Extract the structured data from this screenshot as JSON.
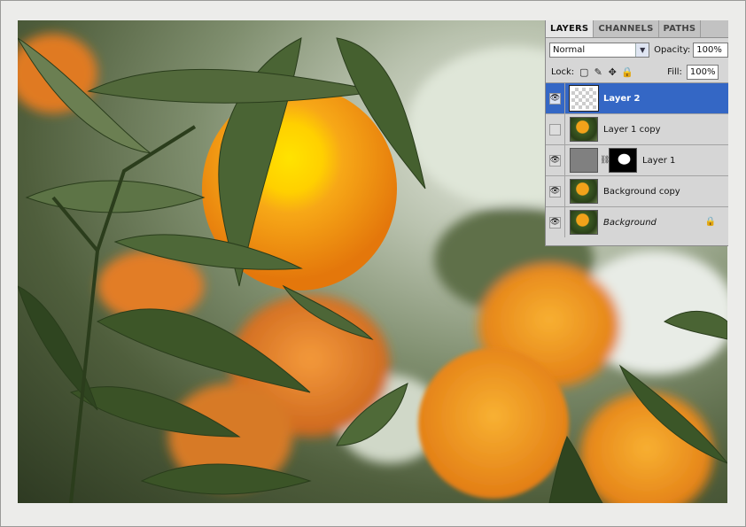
{
  "panel": {
    "tabs": [
      "LAYERS",
      "CHANNELS",
      "PATHS"
    ],
    "active_tab": "LAYERS",
    "blend_mode": "Normal",
    "opacity_label": "Opacity:",
    "opacity_value": "100%",
    "lock_label": "Lock:",
    "fill_label": "Fill:",
    "fill_value": "100%",
    "lock_icons": [
      "lock-transparent-icon",
      "lock-paint-icon",
      "lock-move-icon",
      "lock-all-icon"
    ]
  },
  "layers": [
    {
      "name": "Layer 2",
      "visible": true,
      "selected": true,
      "thumb": "transparent"
    },
    {
      "name": "Layer 1 copy",
      "visible": false,
      "selected": false,
      "thumb": "photo"
    },
    {
      "name": "Layer 1",
      "visible": true,
      "selected": false,
      "thumb": "gray-with-mask"
    },
    {
      "name": "Background copy",
      "visible": true,
      "selected": false,
      "thumb": "photo"
    },
    {
      "name": "Background",
      "visible": true,
      "selected": false,
      "thumb": "photo",
      "locked": true
    }
  ],
  "colors": {
    "selection": "#3467c5",
    "orange_glow": "#ffd400",
    "orange": "#f59a12"
  }
}
